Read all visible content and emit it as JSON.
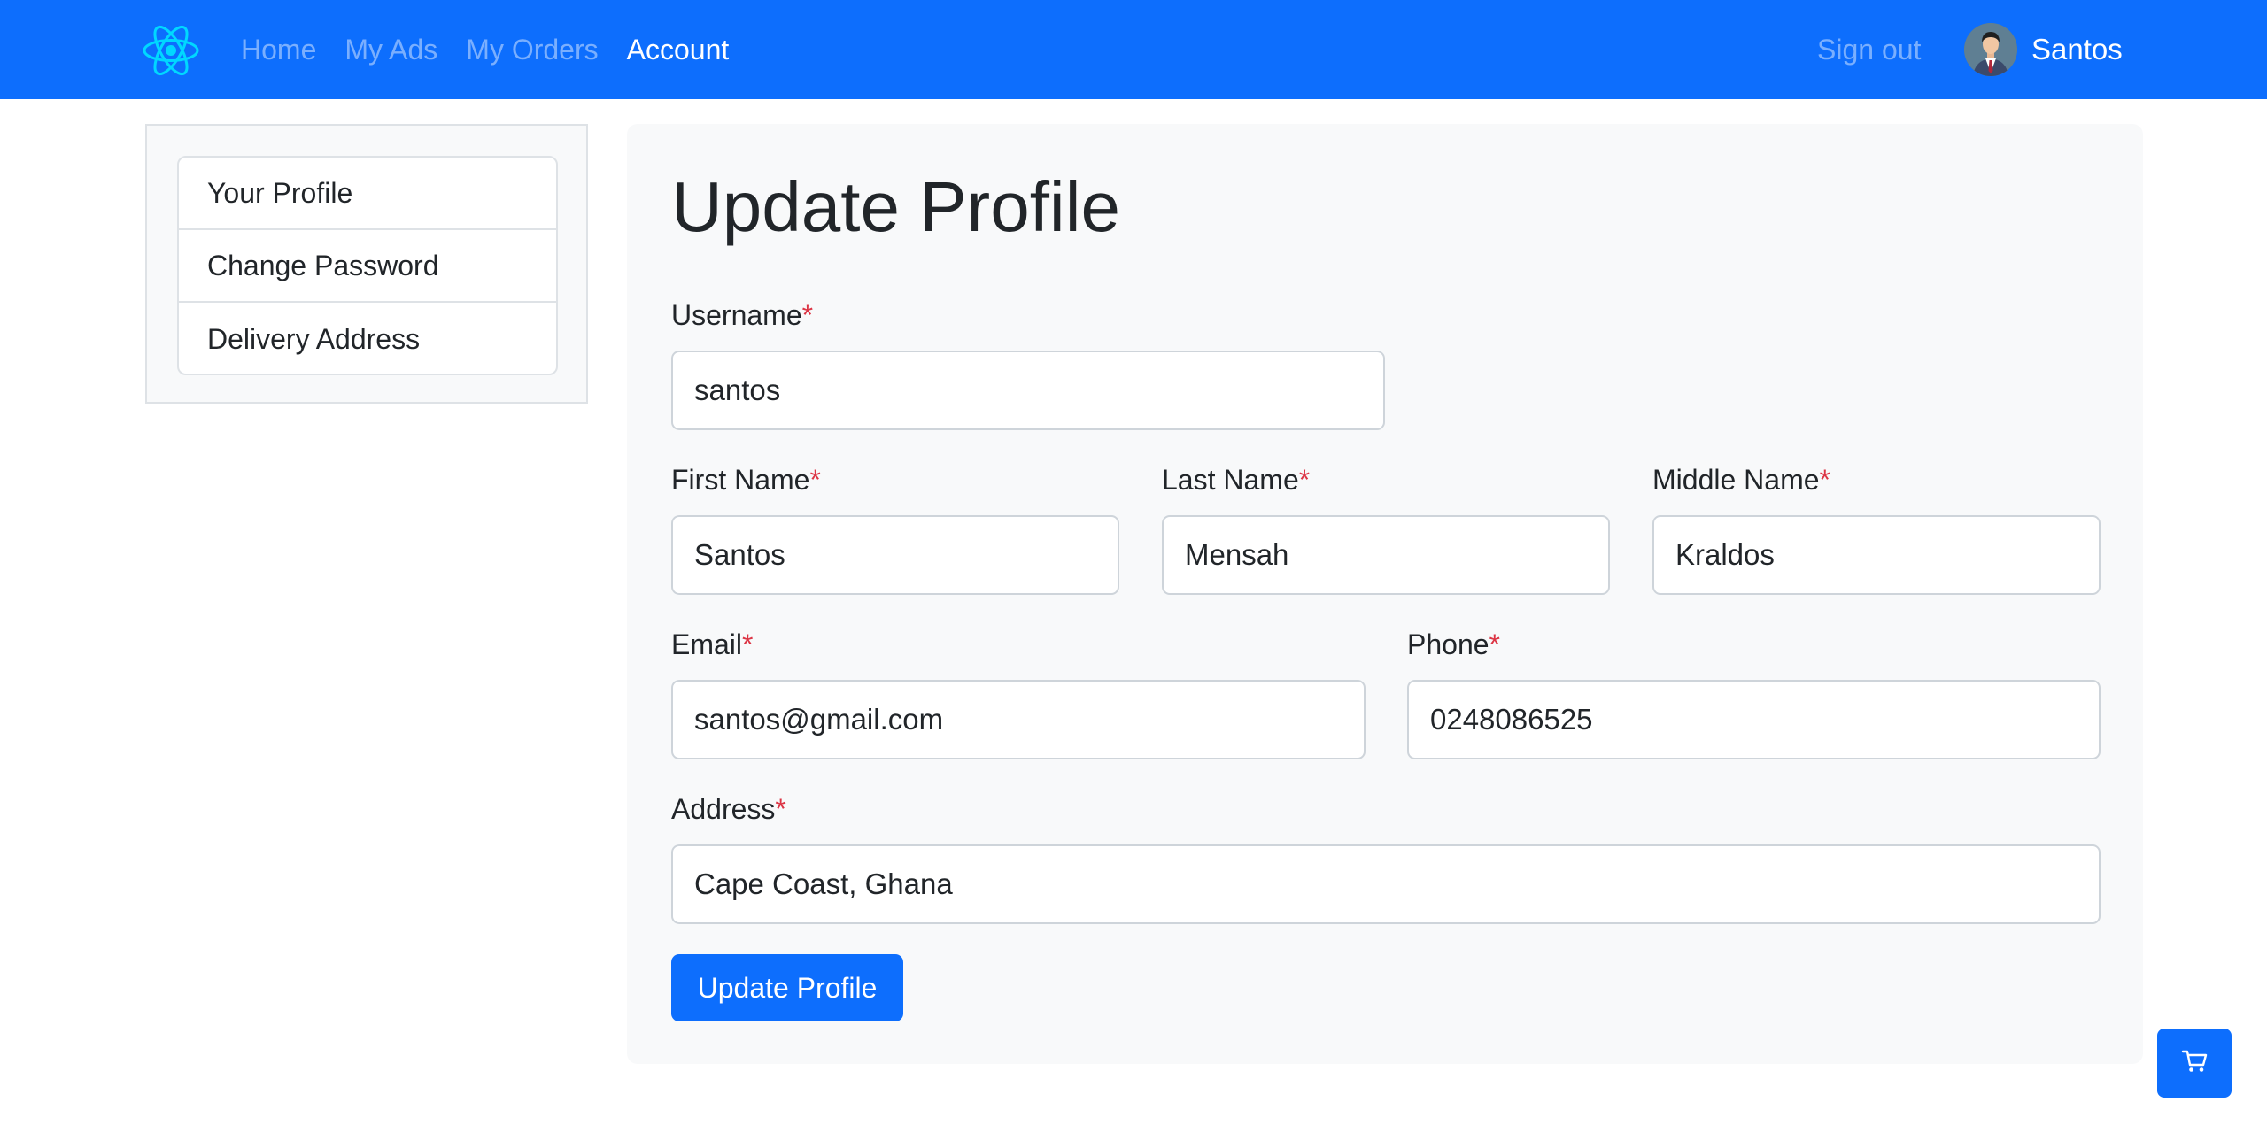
{
  "navbar": {
    "brand_icon": "react-atom-icon",
    "links": [
      {
        "label": "Home",
        "active": false
      },
      {
        "label": "My Ads",
        "active": false
      },
      {
        "label": "My Orders",
        "active": false
      },
      {
        "label": "Account",
        "active": true
      }
    ],
    "signout_label": "Sign out",
    "user_name": "Santos",
    "colors": {
      "bar": "#0d6efd",
      "brand_icon": "#00d8ff"
    }
  },
  "sidebar": {
    "items": [
      {
        "label": "Your Profile"
      },
      {
        "label": "Change Password"
      },
      {
        "label": "Delivery Address"
      }
    ]
  },
  "form": {
    "title": "Update Profile",
    "required_marker": "*",
    "fields": {
      "username": {
        "label": "Username",
        "value": "santos"
      },
      "first_name": {
        "label": "First Name",
        "value": "Santos"
      },
      "last_name": {
        "label": "Last Name",
        "value": "Mensah"
      },
      "middle_name": {
        "label": "Middle Name",
        "value": "Kraldos"
      },
      "email": {
        "label": "Email",
        "value": "santos@gmail.com"
      },
      "phone": {
        "label": "Phone",
        "value": "0248086525"
      },
      "address": {
        "label": "Address",
        "value": "Cape Coast, Ghana"
      }
    },
    "submit_label": "Update Profile"
  },
  "cart": {
    "icon": "cart-icon"
  }
}
